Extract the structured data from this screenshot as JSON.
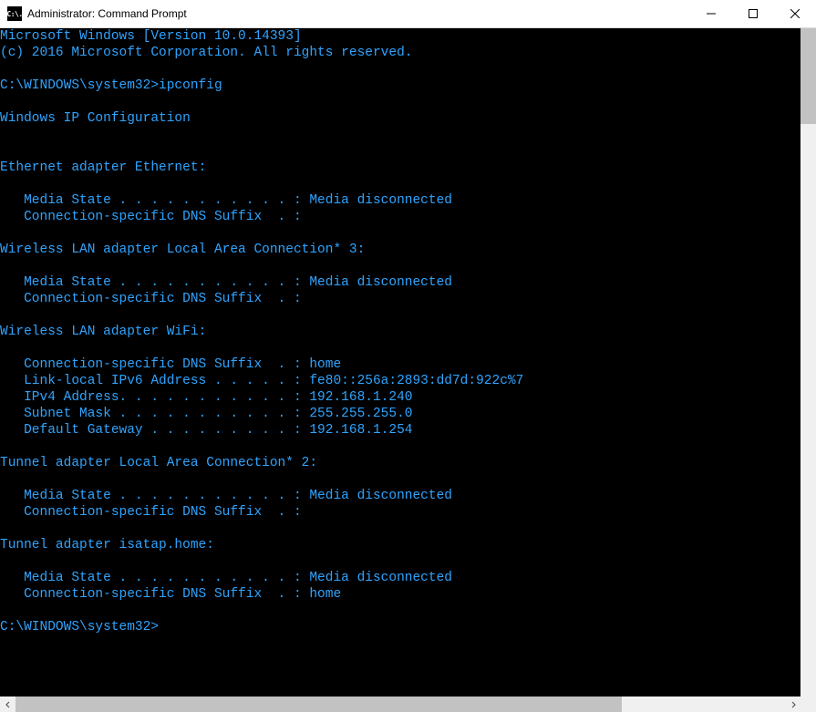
{
  "window": {
    "title": "Administrator: Command Prompt",
    "icon_text": "C:\\."
  },
  "console": {
    "lines": [
      "Microsoft Windows [Version 10.0.14393]",
      "(c) 2016 Microsoft Corporation. All rights reserved.",
      "",
      "C:\\WINDOWS\\system32>ipconfig",
      "",
      "Windows IP Configuration",
      "",
      "",
      "Ethernet adapter Ethernet:",
      "",
      "   Media State . . . . . . . . . . . : Media disconnected",
      "   Connection-specific DNS Suffix  . :",
      "",
      "Wireless LAN adapter Local Area Connection* 3:",
      "",
      "   Media State . . . . . . . . . . . : Media disconnected",
      "   Connection-specific DNS Suffix  . :",
      "",
      "Wireless LAN adapter WiFi:",
      "",
      "   Connection-specific DNS Suffix  . : home",
      "   Link-local IPv6 Address . . . . . : fe80::256a:2893:dd7d:922c%7",
      "   IPv4 Address. . . . . . . . . . . : 192.168.1.240",
      "   Subnet Mask . . . . . . . . . . . : 255.255.255.0",
      "   Default Gateway . . . . . . . . . : 192.168.1.254",
      "",
      "Tunnel adapter Local Area Connection* 2:",
      "",
      "   Media State . . . . . . . . . . . : Media disconnected",
      "   Connection-specific DNS Suffix  . :",
      "",
      "Tunnel adapter isatap.home:",
      "",
      "   Media State . . . . . . . . . . . : Media disconnected",
      "   Connection-specific DNS Suffix  . : home",
      "",
      "C:\\WINDOWS\\system32>"
    ]
  }
}
